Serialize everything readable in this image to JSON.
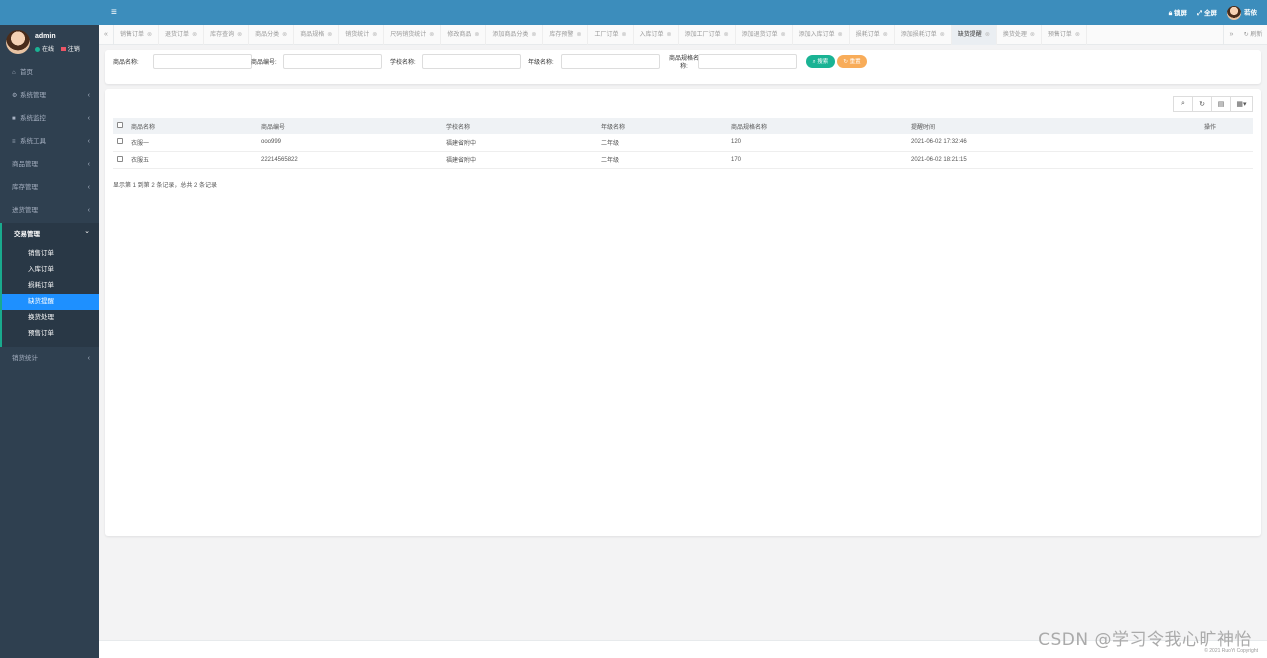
{
  "user": {
    "name": "admin",
    "status_online": "在线",
    "status_logout": "注销"
  },
  "topbar": {
    "lock": "锁屏",
    "fullscreen": "全屏",
    "username": "若依"
  },
  "sidebar": {
    "items": [
      {
        "label": "首页",
        "icon": "home-icon"
      },
      {
        "label": "系统管理",
        "icon": "gear-icon"
      },
      {
        "label": "系统监控",
        "icon": "video-icon"
      },
      {
        "label": "系统工具",
        "icon": "bars-icon"
      },
      {
        "label": "商品管理"
      },
      {
        "label": "库存管理"
      },
      {
        "label": "进货管理"
      }
    ],
    "group": {
      "title": "交易管理",
      "subitems": [
        "销售订单",
        "入库订单",
        "损耗订单",
        "缺货提醒",
        "换货处理",
        "预售订单"
      ],
      "active_index": 3
    },
    "after": [
      {
        "label": "销货统计"
      }
    ]
  },
  "tabs": [
    "销售订单",
    "退货订单",
    "库存查询",
    "商品分类",
    "商品规格",
    "销货统计",
    "尺码销货统计",
    "修改商品",
    "添加商品分类",
    "库存预警",
    "工厂订单",
    "入库订单",
    "添加工厂订单",
    "添加退货订单",
    "添加入库订单",
    "损耗订单",
    "添加损耗订单",
    "缺货提醒",
    "换货处理",
    "预售订单"
  ],
  "active_tab": 17,
  "tab_refresh": "刷新",
  "search": {
    "fields": [
      {
        "label": "商品名称:",
        "value": ""
      },
      {
        "label": "商品编号:",
        "value": ""
      },
      {
        "label": "学校名称:",
        "value": ""
      },
      {
        "label": "年级名称:",
        "value": ""
      },
      {
        "label": "商品规格名称:",
        "value": ""
      }
    ],
    "search_button": "搜索",
    "reset_button": "重置"
  },
  "table": {
    "columns": [
      "商品名称",
      "商品编号",
      "学校名称",
      "年级名称",
      "商品规格名称",
      "提醒时间",
      "操作"
    ],
    "rows": [
      [
        "衣服一",
        "ooo999",
        "福建省附中",
        "二年级",
        "120",
        "2021-06-02 17:32:46",
        ""
      ],
      [
        "衣服五",
        "22214565822",
        "福建省附中",
        "二年级",
        "170",
        "2021-06-02 18:21:15",
        ""
      ]
    ],
    "pager_text": "显示第 1 到第 2 条记录，总共 2 条记录"
  },
  "footer": {
    "copyright": "© 2021 RuoYi Copyright"
  },
  "watermark": "CSDN @学习令我心旷神怡"
}
